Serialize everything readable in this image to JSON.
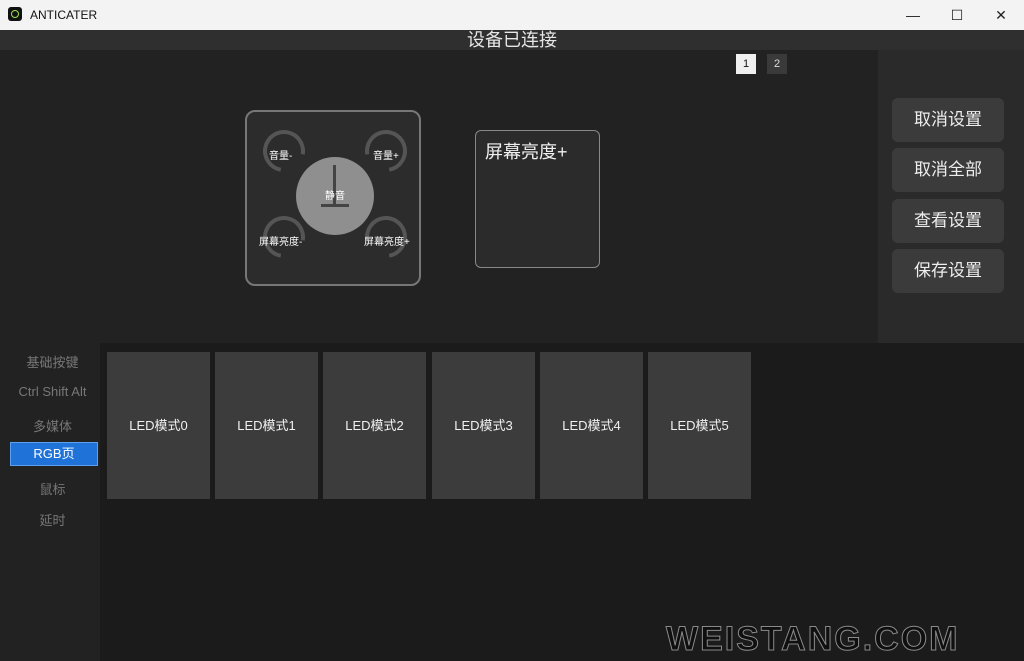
{
  "window": {
    "title": "ANTICATER",
    "minimize": "—",
    "maximize": "☐",
    "close": "✕"
  },
  "status": "设备已连接",
  "pages": [
    "1",
    "2"
  ],
  "knob": {
    "center": "静音",
    "top_left": "音量-",
    "top_right": "音量+",
    "bottom_left": "屏幕亮度-",
    "bottom_right": "屏幕亮度+"
  },
  "mapped_key": "屏幕亮度+",
  "actions": [
    "取消设置",
    "取消全部",
    "查看设置",
    "保存设置"
  ],
  "sidebar": [
    "基础按键",
    "Ctrl Shift Alt",
    "多媒体",
    "RGB页",
    "鼠标",
    "延时"
  ],
  "led_modes": [
    "LED模式0",
    "LED模式1",
    "LED模式2",
    "LED模式3",
    "LED模式4",
    "LED模式5"
  ],
  "watermark": "WEISTANG.COM"
}
